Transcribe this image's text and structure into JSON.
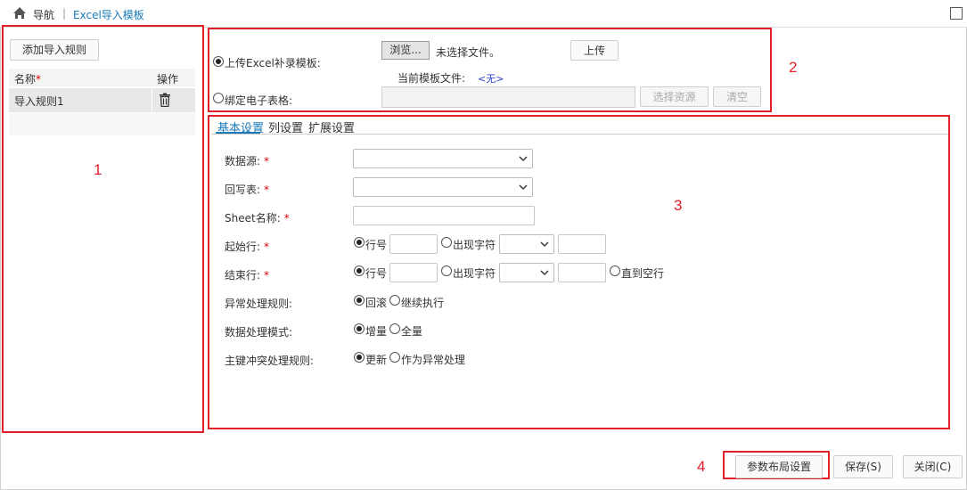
{
  "header": {
    "nav_label": "导航",
    "separator": "|",
    "current_page": "Excel导入模板"
  },
  "sidebar": {
    "add_rule_label": "添加导入规则",
    "col_name": "名称",
    "col_name_required": "*",
    "col_action": "操作",
    "rules": [
      {
        "name": "导入规则1"
      }
    ]
  },
  "upload": {
    "upload_option_label": "上传Excel补录模板:",
    "browse_label": "浏览...",
    "no_file_label": "未选择文件。",
    "upload_button": "上传",
    "current_template_label": "当前模板文件:",
    "current_template_value": "<无>",
    "bind_option_label": "绑定电子表格:",
    "select_resource_button": "选择资源",
    "clear_button": "清空",
    "selected_option": "upload"
  },
  "tabs": [
    {
      "label": "基本设置",
      "active": true
    },
    {
      "label": "列设置",
      "active": false
    },
    {
      "label": "扩展设置",
      "active": false
    }
  ],
  "form": {
    "data_source_label": "数据源:",
    "writeback_table_label": "回写表:",
    "sheet_name_label": "Sheet名称:",
    "start_row_label": "起始行:",
    "end_row_label": "结束行:",
    "exception_rule_label": "异常处理规则:",
    "data_mode_label": "数据处理模式:",
    "pk_conflict_label": "主键冲突处理规则:",
    "required_mark": "*",
    "row_number_option": "行号",
    "appear_char_option": "出现字符",
    "until_empty_option": "直到空行",
    "rollback_option": "回滚",
    "continue_option": "继续执行",
    "incremental_option": "增量",
    "full_option": "全量",
    "update_option": "更新",
    "as_exception_option": "作为异常处理"
  },
  "footer": {
    "param_layout_button": "参数布局设置",
    "save_button": "保存(S)",
    "close_button": "关闭(C)"
  },
  "annotations": [
    "1",
    "2",
    "3",
    "4"
  ],
  "colors": {
    "accent": "#1a7ab8",
    "annotation_red": "#e0202a",
    "required_red": "#d40000"
  }
}
